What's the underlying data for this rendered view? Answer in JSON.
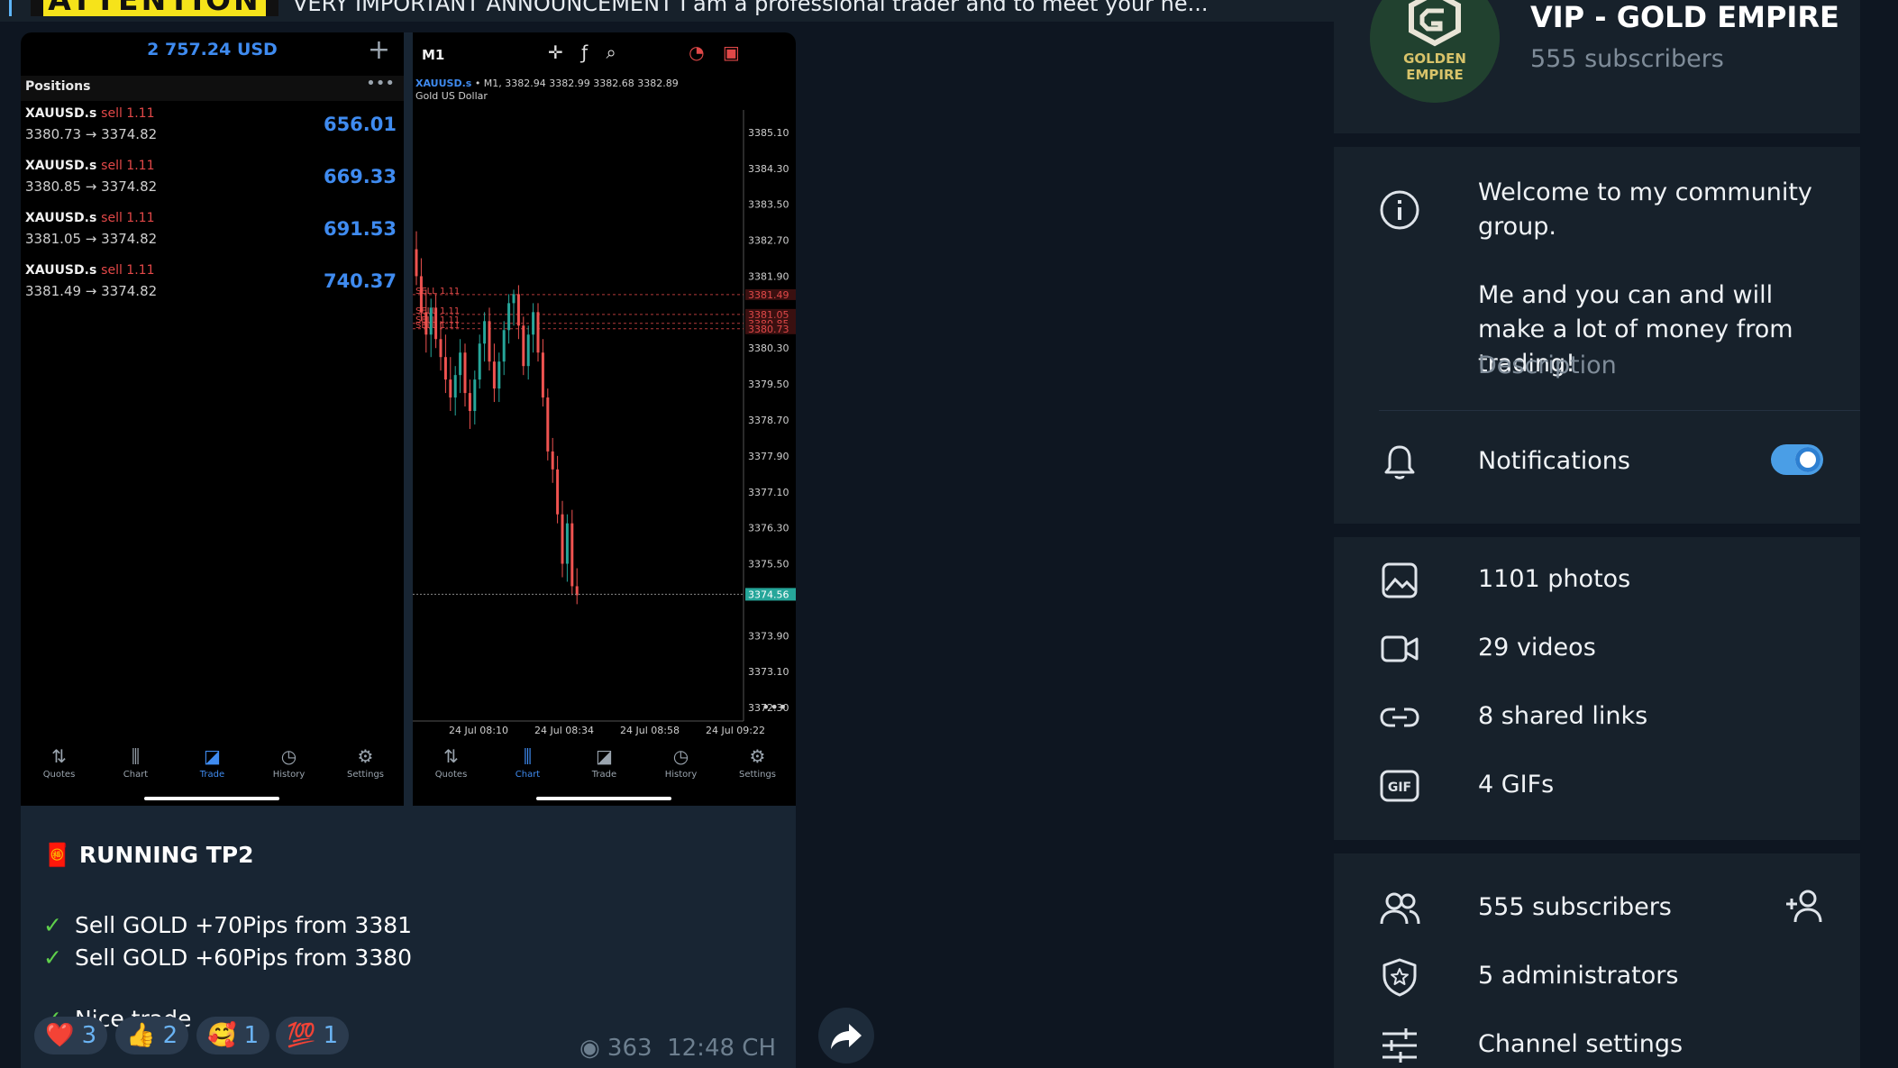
{
  "pinned": {
    "thumb_label": "ATTENTION",
    "text": "VERY IMPORTANT ANNOUNCEMENT  I am a professional trader and to meet your ne..."
  },
  "positions_screen": {
    "balance": "2 757.24 USD",
    "section_title": "Positions",
    "positions": [
      {
        "symbol": "XAUUSD.s",
        "side": "sell 1.11",
        "prices": "3380.73 → 3374.82",
        "pl": "656.01"
      },
      {
        "symbol": "XAUUSD.s",
        "side": "sell 1.11",
        "prices": "3380.85 → 3374.82",
        "pl": "669.33"
      },
      {
        "symbol": "XAUUSD.s",
        "side": "sell 1.11",
        "prices": "3381.05 → 3374.82",
        "pl": "691.53"
      },
      {
        "symbol": "XAUUSD.s",
        "side": "sell 1.11",
        "prices": "3381.49 → 3374.82",
        "pl": "740.37"
      }
    ],
    "nav": [
      {
        "icon": "quotes-icon",
        "label": "Quotes",
        "active": false
      },
      {
        "icon": "chart-icon",
        "label": "Chart",
        "active": false
      },
      {
        "icon": "trade-icon",
        "label": "Trade",
        "active": true
      },
      {
        "icon": "history-icon",
        "label": "History",
        "active": false
      },
      {
        "icon": "settings-icon",
        "label": "Settings",
        "active": false
      }
    ]
  },
  "chart_screen": {
    "timeframe": "M1",
    "ticker": "XAUUSD.s",
    "ticker_ohlc": "• M1, 3382.94 3382.99 3382.68 3382.89",
    "description": "Gold US Dollar",
    "nav": [
      {
        "icon": "quotes-icon",
        "label": "Quotes",
        "active": false
      },
      {
        "icon": "chart-icon",
        "label": "Chart",
        "active": true
      },
      {
        "icon": "trade-icon",
        "label": "Trade",
        "active": false
      },
      {
        "icon": "history-icon",
        "label": "History",
        "active": false
      },
      {
        "icon": "settings-icon",
        "label": "Settings",
        "active": false
      }
    ]
  },
  "chart_data": {
    "type": "candlestick",
    "title": "",
    "ylim": [
      3372.0,
      3385.6
    ],
    "y_ticks": [
      "3385.10",
      "3384.30",
      "3383.50",
      "3382.70",
      "3381.90",
      "3380.30",
      "3379.50",
      "3378.70",
      "3377.90",
      "3377.10",
      "3376.30",
      "3375.50",
      "3373.90",
      "3373.10",
      "3372.30"
    ],
    "x_ticks": [
      "24 Jul 08:10",
      "24 Jul 08:34",
      "24 Jul 08:58",
      "24 Jul 09:22"
    ],
    "order_lines": [
      {
        "label": "SELL 1.11",
        "price": 3381.49,
        "price_label": "3381.49"
      },
      {
        "label": "SELL 1.11",
        "price": 3381.05,
        "price_label": "3381.05"
      },
      {
        "label": "SELL 1.11",
        "price": 3380.85,
        "price_label": "3380.85"
      },
      {
        "label": "SELL 1.11",
        "price": 3380.73,
        "price_label": "3380.73"
      }
    ],
    "current_price": 3374.82,
    "current_price_label": "3374.56",
    "candles": [
      {
        "o": 3382.5,
        "h": 3382.9,
        "l": 3381.7,
        "c": 3381.9
      },
      {
        "o": 3381.9,
        "h": 3382.3,
        "l": 3380.9,
        "c": 3381.1
      },
      {
        "o": 3381.1,
        "h": 3381.6,
        "l": 3380.2,
        "c": 3380.6
      },
      {
        "o": 3380.6,
        "h": 3381.4,
        "l": 3380.1,
        "c": 3381.2
      },
      {
        "o": 3381.2,
        "h": 3381.5,
        "l": 3380.3,
        "c": 3380.5
      },
      {
        "o": 3380.5,
        "h": 3380.9,
        "l": 3379.8,
        "c": 3380.1
      },
      {
        "o": 3380.1,
        "h": 3380.6,
        "l": 3379.3,
        "c": 3379.6
      },
      {
        "o": 3379.6,
        "h": 3380.1,
        "l": 3378.9,
        "c": 3379.2
      },
      {
        "o": 3379.2,
        "h": 3379.9,
        "l": 3378.8,
        "c": 3379.7
      },
      {
        "o": 3379.7,
        "h": 3380.5,
        "l": 3379.3,
        "c": 3380.2
      },
      {
        "o": 3380.2,
        "h": 3380.4,
        "l": 3379.0,
        "c": 3379.3
      },
      {
        "o": 3379.3,
        "h": 3379.6,
        "l": 3378.5,
        "c": 3378.9
      },
      {
        "o": 3378.9,
        "h": 3379.8,
        "l": 3378.6,
        "c": 3379.6
      },
      {
        "o": 3379.6,
        "h": 3380.6,
        "l": 3379.4,
        "c": 3380.4
      },
      {
        "o": 3380.4,
        "h": 3381.1,
        "l": 3380.0,
        "c": 3380.9
      },
      {
        "o": 3380.9,
        "h": 3381.2,
        "l": 3379.8,
        "c": 3380.0
      },
      {
        "o": 3380.0,
        "h": 3380.4,
        "l": 3379.1,
        "c": 3379.4
      },
      {
        "o": 3379.4,
        "h": 3380.2,
        "l": 3379.1,
        "c": 3380.0
      },
      {
        "o": 3380.0,
        "h": 3380.9,
        "l": 3379.7,
        "c": 3380.7
      },
      {
        "o": 3380.7,
        "h": 3381.5,
        "l": 3380.4,
        "c": 3381.3
      },
      {
        "o": 3381.3,
        "h": 3381.6,
        "l": 3380.8,
        "c": 3381.5
      },
      {
        "o": 3381.5,
        "h": 3381.7,
        "l": 3380.5,
        "c": 3380.8
      },
      {
        "o": 3380.8,
        "h": 3381.0,
        "l": 3379.7,
        "c": 3379.9
      },
      {
        "o": 3379.9,
        "h": 3380.8,
        "l": 3379.6,
        "c": 3380.6
      },
      {
        "o": 3380.6,
        "h": 3381.3,
        "l": 3380.2,
        "c": 3381.1
      },
      {
        "o": 3381.1,
        "h": 3381.3,
        "l": 3380.0,
        "c": 3380.2
      },
      {
        "o": 3380.2,
        "h": 3380.5,
        "l": 3379.0,
        "c": 3379.2
      },
      {
        "o": 3379.2,
        "h": 3379.4,
        "l": 3377.8,
        "c": 3378.0
      },
      {
        "o": 3378.0,
        "h": 3378.3,
        "l": 3377.3,
        "c": 3377.6
      },
      {
        "o": 3377.6,
        "h": 3377.9,
        "l": 3376.4,
        "c": 3376.6
      },
      {
        "o": 3376.6,
        "h": 3376.9,
        "l": 3375.2,
        "c": 3375.5
      },
      {
        "o": 3375.5,
        "h": 3376.6,
        "l": 3375.1,
        "c": 3376.4
      },
      {
        "o": 3376.4,
        "h": 3376.7,
        "l": 3374.8,
        "c": 3375.0
      },
      {
        "o": 3375.0,
        "h": 3375.4,
        "l": 3374.6,
        "c": 3374.8
      }
    ]
  },
  "caption": {
    "heading_emoji": "🧧",
    "heading": "RUNNING TP2",
    "lines": [
      "Sell GOLD +70Pips from 3381",
      "Sell GOLD +60Pips from 3380",
      "Nice trade"
    ],
    "check_glyph": "✓"
  },
  "reactions": [
    {
      "emoji": "❤️",
      "count": "3"
    },
    {
      "emoji": "👍",
      "count": "2"
    },
    {
      "emoji": "🥰",
      "count": "1"
    },
    {
      "emoji": "💯",
      "count": "1"
    }
  ],
  "meta": {
    "views": "363",
    "time": "12:48 CH"
  },
  "panel": {
    "channel_name": "VIP - GOLD EMPIRE",
    "channel_subscribers": "555 subscribers",
    "avatar_text": "GOLDEN EMPIRE",
    "about": "Welcome to my community group.",
    "about_2": "Me and you can and will make a lot of money from trading!",
    "about_label": "Description",
    "notifications_label": "Notifications",
    "notifications_on": true,
    "media": [
      {
        "icon": "photo-icon",
        "label": "1101 photos"
      },
      {
        "icon": "video-icon",
        "label": "29 videos"
      },
      {
        "icon": "link-icon",
        "label": "8 shared links"
      },
      {
        "icon": "gif-icon",
        "label": "4 GIFs"
      }
    ],
    "members": [
      {
        "icon": "subscribers-icon",
        "label": "555 subscribers"
      },
      {
        "icon": "admin-shield-icon",
        "label": "5 administrators"
      },
      {
        "icon": "settings-sliders-icon",
        "label": "Channel settings"
      }
    ]
  },
  "colors": {
    "accent": "#4a9ee6",
    "bull": "#26a69a",
    "bear": "#ef5350",
    "link_blue": "#6ab3f3"
  }
}
